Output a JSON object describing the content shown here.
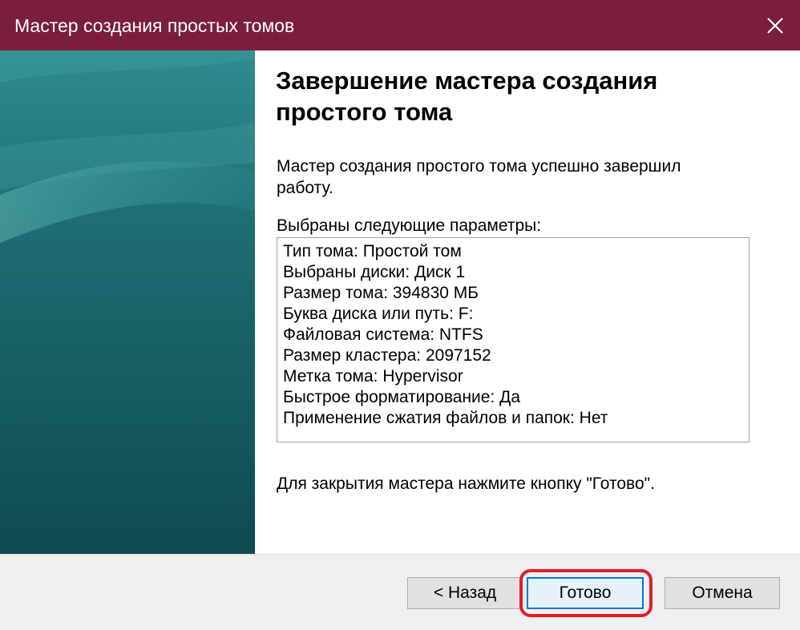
{
  "window": {
    "title": "Мастер создания простых томов",
    "close_icon": "close-icon"
  },
  "main": {
    "heading": "Завершение мастера создания простого тома",
    "completion_text": "Мастер создания простого тома успешно завершил работу.",
    "params_label": "Выбраны следующие параметры:",
    "params": [
      "Тип тома: Простой том",
      "Выбраны диски: Диск 1",
      "Размер тома: 394830 МБ",
      "Буква диска или путь: F:",
      "Файловая система: NTFS",
      "Размер кластера: 2097152",
      "Метка тома: Hypervisor",
      "Быстрое форматирование: Да",
      "Применение сжатия файлов и папок: Нет"
    ],
    "footer_text": "Для закрытия мастера нажмите кнопку \"Готово\"."
  },
  "buttons": {
    "back": "< Назад",
    "finish": "Готово",
    "cancel": "Отмена"
  },
  "colors": {
    "titlebar": "#7b1e3c",
    "side_panel": "#1f6e73",
    "highlight": "#e01e2a",
    "focus_border": "#0078d7"
  }
}
